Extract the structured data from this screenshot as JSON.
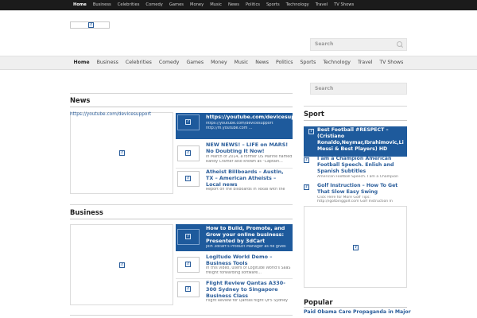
{
  "topbar": {
    "nav": [
      "Home",
      "Business",
      "Celebrities",
      "Comedy",
      "Games",
      "Money",
      "Music",
      "News",
      "Politics",
      "Sports",
      "Technology",
      "Travel",
      "TV Shows"
    ]
  },
  "search": {
    "placeholder": "Search"
  },
  "mainnav": {
    "items": [
      "Home",
      "Business",
      "Celebrities",
      "Comedy",
      "Games",
      "Money",
      "Music",
      "News",
      "Politics",
      "Sports",
      "Technology",
      "Travel",
      "TV Shows"
    ]
  },
  "broken_image_glyph": "?",
  "news": {
    "title": "News",
    "featured_url": "https://youtube.com/devicesupport",
    "items": [
      {
        "title": "https://youtube.com/devicesupport",
        "excerpt": [
          "https://youtube.com/devicesupport",
          "http://m.youtube.com ..."
        ]
      },
      {
        "title": "NEW NEWS! – LIFE on MARS! No Doubting It Now!",
        "excerpt": [
          "In March of 2014, a former US Marine named",
          "Randy Cramer also known as \"Captain..."
        ]
      },
      {
        "title": "Atheist Billboards – Austin, TX – American Atheists – Local news",
        "excerpt": [
          "Report on the billboards in Texas with the"
        ]
      }
    ]
  },
  "business": {
    "title": "Business",
    "items": [
      {
        "title": "How to Build, Promote, and Grow your online business: Presented by 3dCart",
        "excerpt": [
          "Join 3dcart's Product Manager as he gives"
        ]
      },
      {
        "title": "Logitude World Demo – Business Tools",
        "excerpt": [
          "In this video, users of Logitude World's SaaS",
          "freight forwarding software..."
        ]
      },
      {
        "title": "Flight Review Qantas A330-300 Sydney to Singapore Business Class",
        "excerpt": [
          "Flight Review for Qantas flight QF5 Sydney"
        ]
      }
    ]
  },
  "sport": {
    "title": "Sport",
    "items": [
      {
        "title": "Best Football #RESPECT – (Cristiano Ronaldo,Neymar,Ibrahimovic,Li Messi & Best Players) HD",
        "excerpt": []
      },
      {
        "title": "I am a Champion American Football Speech. Enlish and Spanish Subtitles",
        "excerpt": [
          "American Football Speech. I am a Champion"
        ]
      },
      {
        "title": "Golf Instruction – How To Get That Slow Easy Swing",
        "excerpt": [
          "Click Here for More Golf Tips:",
          "http://igotbinggolf.com Golf Instruction In"
        ]
      }
    ]
  },
  "popular": {
    "title": "Popular",
    "first": "Paid Obama Care Propaganda in Major"
  }
}
